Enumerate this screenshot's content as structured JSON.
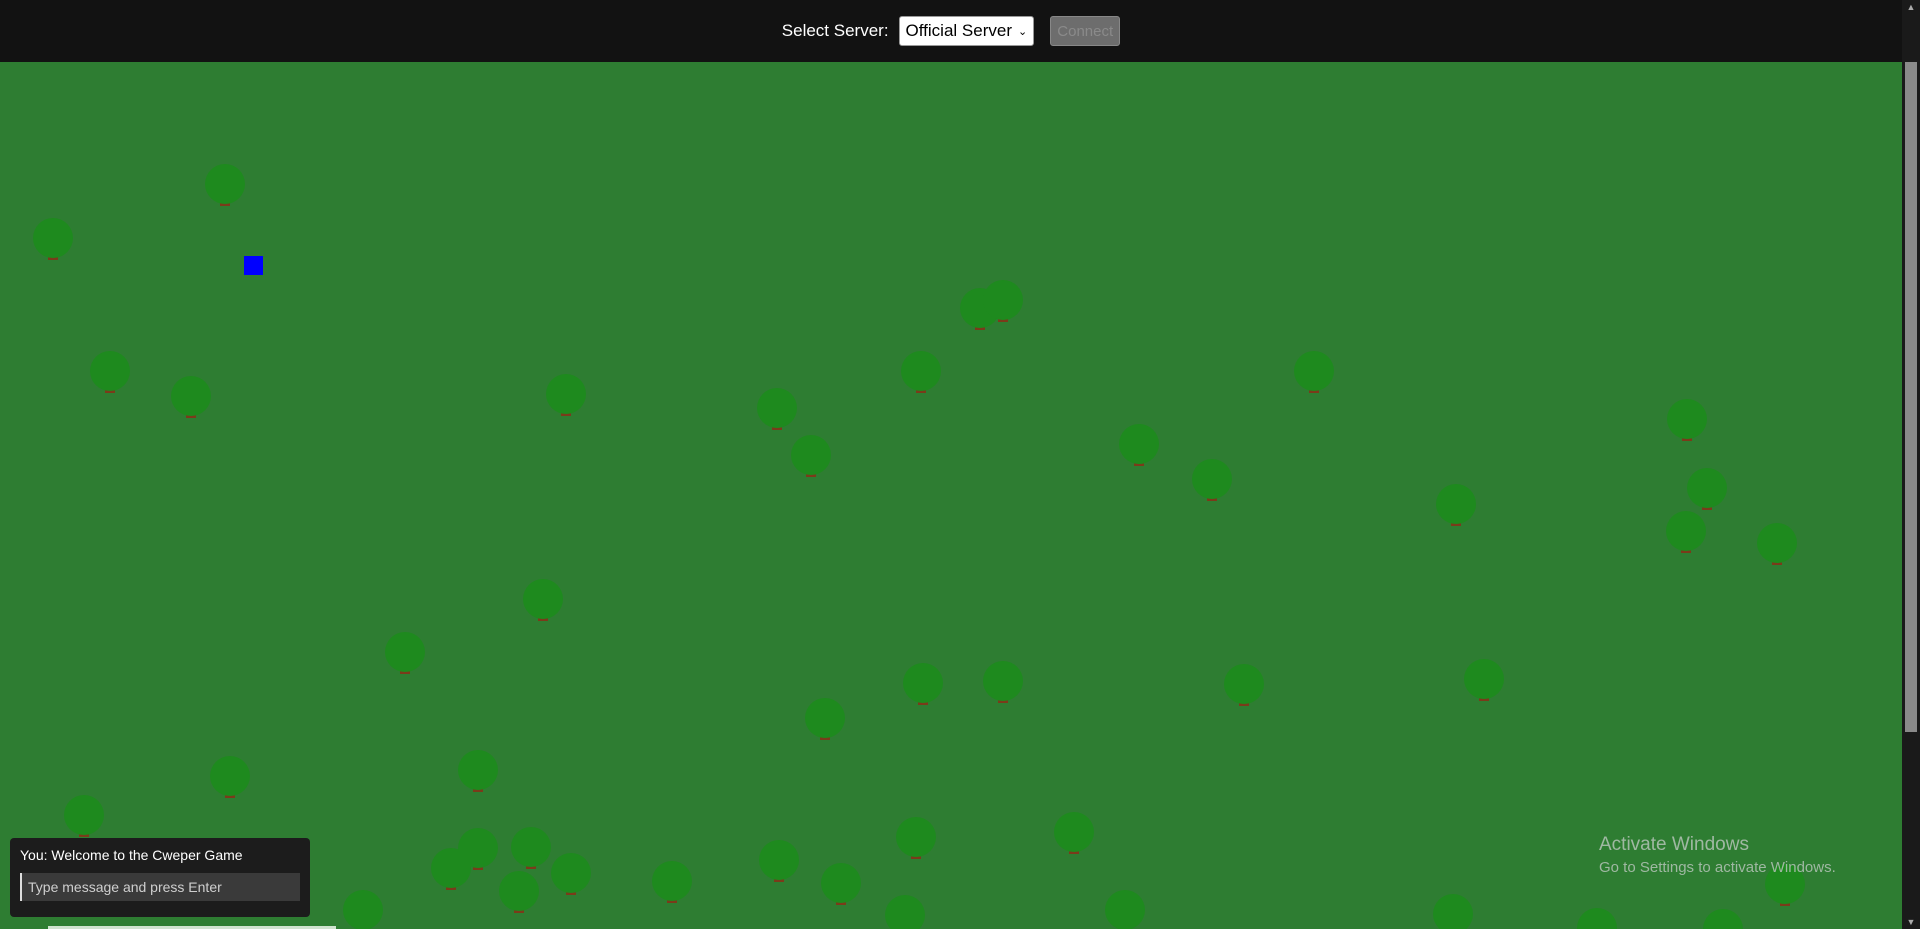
{
  "topbar": {
    "server_label": "Select Server:",
    "server_selected": "Official Server",
    "connect_label": "Connect"
  },
  "colors": {
    "grass": "#2e7d32",
    "tree_canopy": "#1e8a1e",
    "tree_trunk": "#7a3b1a",
    "player": "#0000ff"
  },
  "chat": {
    "messages": [
      "You: Welcome to the Cweper Game"
    ],
    "placeholder": "Type message and press Enter"
  },
  "watermark": {
    "title": "Activate Windows",
    "subtitle": "Go to Settings to activate Windows."
  }
}
